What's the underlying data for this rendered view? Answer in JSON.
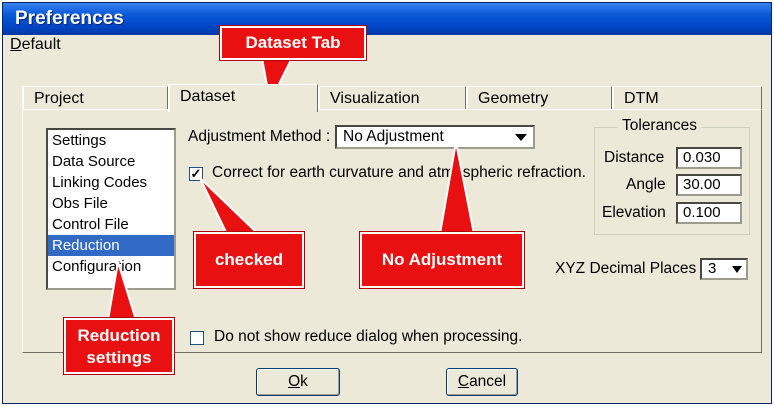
{
  "window": {
    "title": "Preferences"
  },
  "menu": {
    "default_accel": "D",
    "default_rest": "efault"
  },
  "tabs": [
    {
      "label": "Project"
    },
    {
      "label": "Dataset"
    },
    {
      "label": "Visualization"
    },
    {
      "label": "Geometry"
    },
    {
      "label": "DTM"
    }
  ],
  "sidebar": {
    "items": [
      {
        "label": "Settings"
      },
      {
        "label": "Data Source"
      },
      {
        "label": "Linking Codes"
      },
      {
        "label": "Obs File"
      },
      {
        "label": "Control File"
      },
      {
        "label": "Reduction",
        "selected": true
      },
      {
        "label": "Configuration"
      }
    ]
  },
  "adjustment": {
    "label": "Adjustment Method :",
    "value": "No Adjustment"
  },
  "curvature": {
    "checked": true,
    "label": "Correct for earth curvature and atmospheric refraction."
  },
  "tolerances": {
    "title": "Tolerances",
    "distance_label": "Distance",
    "distance_value": "0.030",
    "angle_label": "Angle",
    "angle_value": "30.00",
    "elevation_label": "Elevation",
    "elevation_value": "0.100"
  },
  "xyz": {
    "label": "XYZ Decimal Places",
    "value": "3"
  },
  "reduce_dialog": {
    "checked": false,
    "label": "Do not show reduce dialog when processing."
  },
  "buttons": {
    "ok_accel": "O",
    "ok_rest": "k",
    "cancel_accel": "C",
    "cancel_rest": "ancel"
  },
  "callouts": {
    "dataset_tab": "Dataset Tab",
    "checked": "checked",
    "no_adjustment": "No Adjustment",
    "reduction_line1": "Reduction",
    "reduction_line2": "settings"
  },
  "colors": {
    "callout": "#e81010",
    "titlebar": "#0048c8",
    "selection": "#316ac5"
  }
}
